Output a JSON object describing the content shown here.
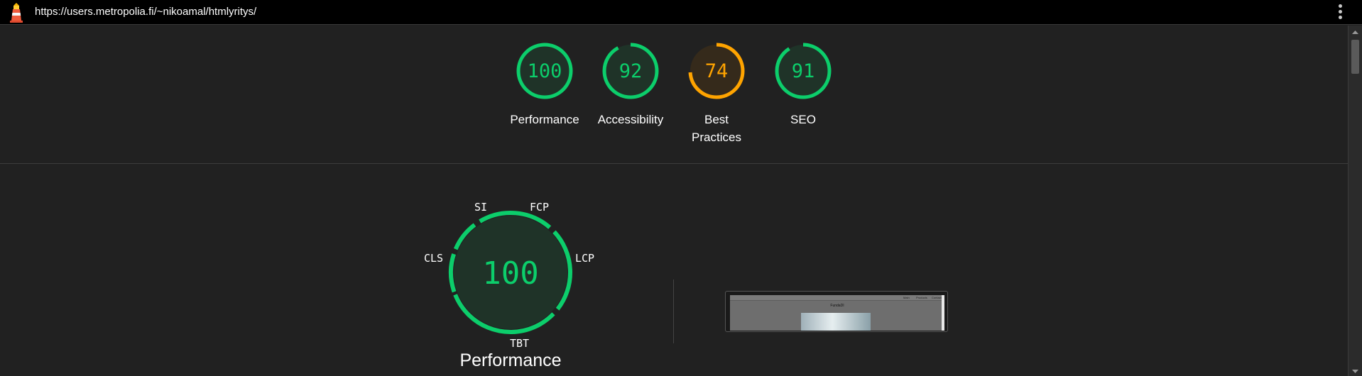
{
  "header": {
    "url": "https://users.metropolia.fi/~nikoamal/htmlyritys/"
  },
  "colors": {
    "pass": "#0cce6b",
    "average": "#ffa400",
    "pass_bg": "#1f3328",
    "average_bg": "#352a1b"
  },
  "categories": [
    {
      "score": 100,
      "label": "Performance",
      "status": "pass"
    },
    {
      "score": 92,
      "label": "Accessibility",
      "status": "pass"
    },
    {
      "score": 74,
      "label": "Best Practices",
      "status": "average"
    },
    {
      "score": 91,
      "label": "SEO",
      "status": "pass"
    }
  ],
  "performance": {
    "score": "100",
    "title": "Performance",
    "metrics": {
      "si": "SI",
      "fcp": "FCP",
      "lcp": "LCP",
      "tbt": "TBT",
      "cls": "CLS"
    }
  },
  "thumbnail": {
    "title": "FundaDI",
    "nav": [
      "Main",
      "Products",
      "Contact"
    ]
  },
  "icons": {
    "logo": "lighthouse-icon",
    "menu": "more-vert-icon"
  }
}
